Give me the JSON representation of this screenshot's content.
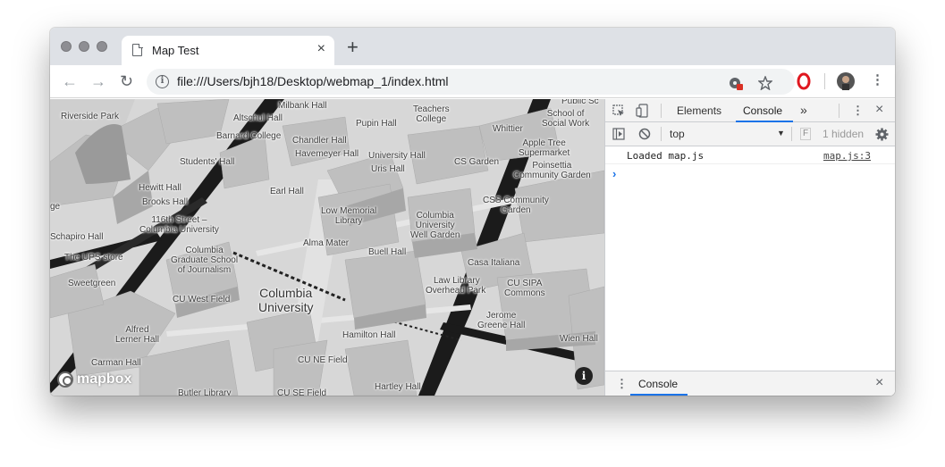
{
  "browser": {
    "tab_title": "Map Test",
    "tab_close": "×",
    "new_tab": "+",
    "url": "file:///Users/bjh18/Desktop/webmap_1/index.html",
    "nav": {
      "back": "←",
      "forward": "→",
      "reload": "↻"
    }
  },
  "map": {
    "labels": {
      "riverside_park": "Riverside Park",
      "altschul_hall": "Altschul Hall",
      "milbank_hall": "Milbank Hall",
      "teachers_college": "Teachers\nCollege",
      "public_sc": "Public Sc",
      "school_of_social_work": "School of\nSocial Work",
      "barnard_college": "Barnard College",
      "chandler_hall": "Chandler Hall",
      "pupin_hall": "Pupin Hall",
      "whittier": "Whittier",
      "apple_tree": "Apple Tree\nSupermarket",
      "havemeyer_hall": "Havemeyer Hall",
      "university_hall": "University Hall",
      "students_hall": "Students' Hall",
      "uris_hall": "Uris Hall",
      "cs_garden": "CS Garden",
      "poinsettia": "Poinsettia\nCommunity Garden",
      "hewitt_hall": "Hewitt Hall",
      "earl_hall": "Earl Hall",
      "brooks_hall": "Brooks Hall",
      "low_memorial": "Low Memorial\nLibrary",
      "css_community": "CSS Community\nGarden",
      "ge": "ge",
      "st_116": "116th Street –\nColumbia University",
      "columbia_wellgarden": "Columbia\nUniversity\nWell Garden",
      "schapiro_hall": "Schapiro Hall",
      "alma_mater": "Alma Mater",
      "columbia_journalism": "Columbia\nGraduate School\nof Journalism",
      "buell_hall": "Buell Hall",
      "ups_store": "The UPS store",
      "casa_italiana": "Casa Italiana",
      "sweetgreen": "Sweetgreen",
      "law_library": "Law Library",
      "cu_sipa": "CU SIPA\nCommons",
      "overhead_park": "Overhead Park",
      "columbia_university": "Columbia\nUniversity",
      "cu_west_field": "CU West Field",
      "jerome_greene": "Jerome\nGreene Hall",
      "alfred_lerner": "Alfred\nLerner Hall",
      "hamilton_hall": "Hamilton Hall",
      "wien_hall": "Wien Hall",
      "carman_hall": "Carman Hall",
      "cu_ne_field": "CU NE Field",
      "hartley_hall": "Hartley Hall",
      "butler_library": "Butler Library",
      "cu_se_field": "CU SE Field"
    },
    "logo_text": "mapbox",
    "attribution_icon": "i"
  },
  "devtools": {
    "tabs": [
      "Elements",
      "Console"
    ],
    "more": "»",
    "context": "top",
    "filter_char": "F",
    "hidden": "1 hidden",
    "console": {
      "message": "Loaded map.js",
      "source": "map.js:3",
      "prompt": "›"
    },
    "drawer_tab": "Console",
    "close": "×"
  },
  "colors": {
    "tabbar": "#dee1e6",
    "accent": "#1a73e8",
    "map_ground": "#d9d9d9",
    "road": "#1b1b1b"
  }
}
